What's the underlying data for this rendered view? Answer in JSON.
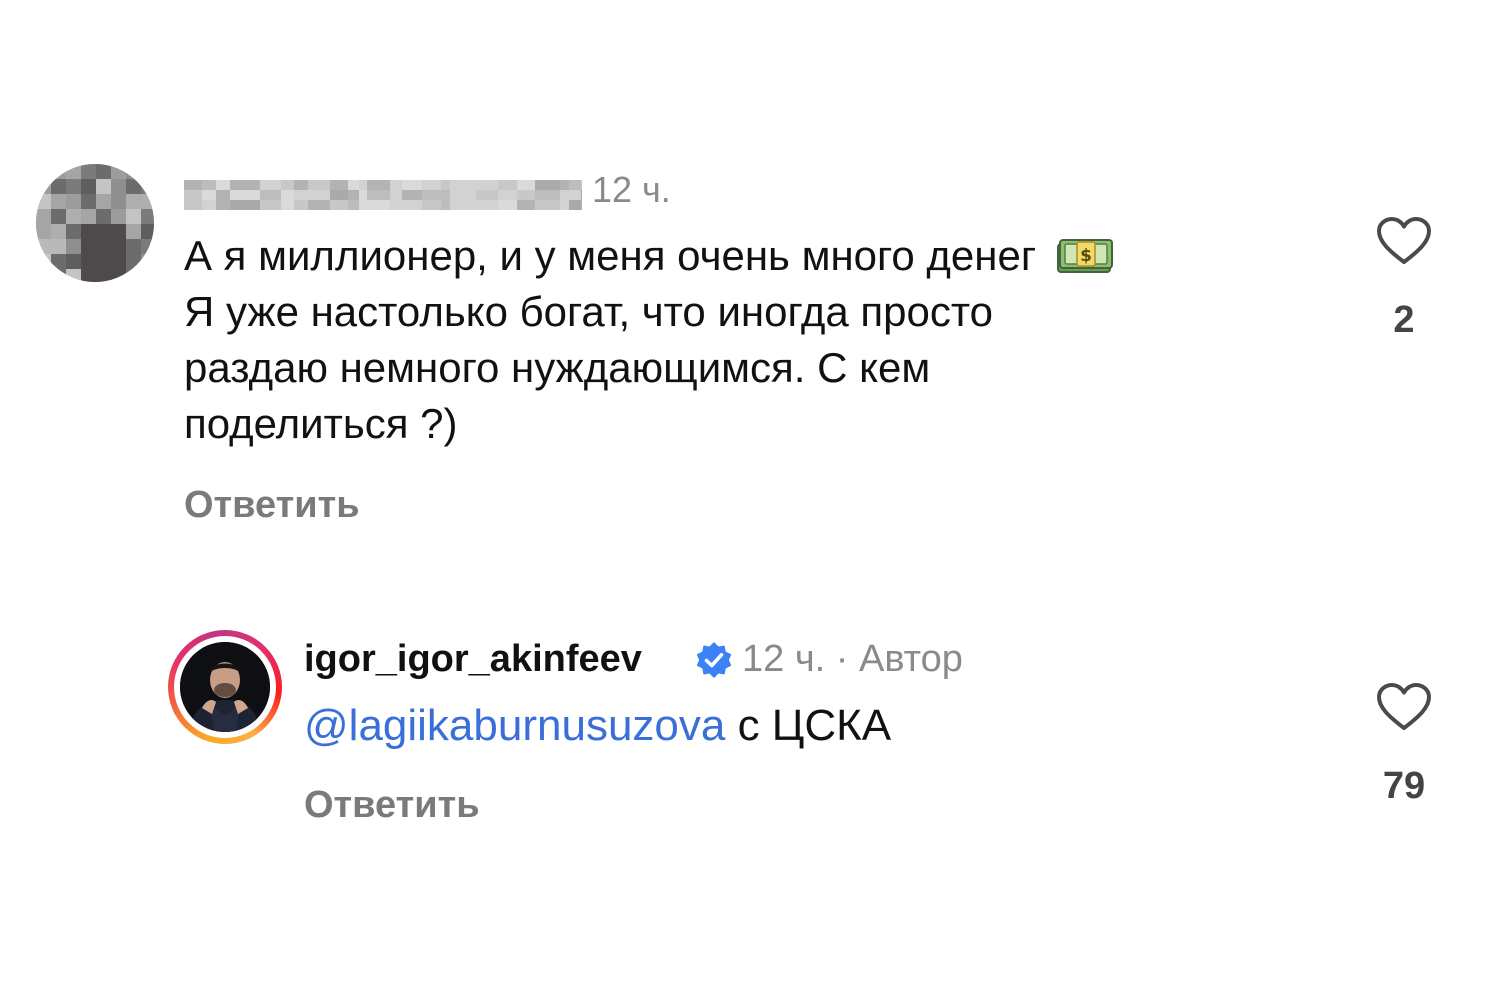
{
  "comments": [
    {
      "time": "12 ч.",
      "text_lines": [
        "А я миллионер, и у меня очень много денег",
        "Я уже настолько богат, что иногда просто",
        "раздаю немного нуждающимся. С кем",
        "поделиться ?)"
      ],
      "emoji": "money-with-wings",
      "reply_label": "Ответить",
      "likes": "2"
    },
    {
      "username": "igor_igor_akinfeev",
      "verified": true,
      "time": "12 ч.",
      "separator": " · ",
      "author_badge": "Автор",
      "mention": "@lagiikaburnusuzova",
      "text": " с ЦСКА",
      "reply_label": "Ответить",
      "likes": "79"
    }
  ],
  "colors": {
    "mention": "#3b6fd8",
    "muted_text": "#8a8a8a",
    "reply_text": "#7a7a7a",
    "verified_badge": "#3b82f6"
  }
}
